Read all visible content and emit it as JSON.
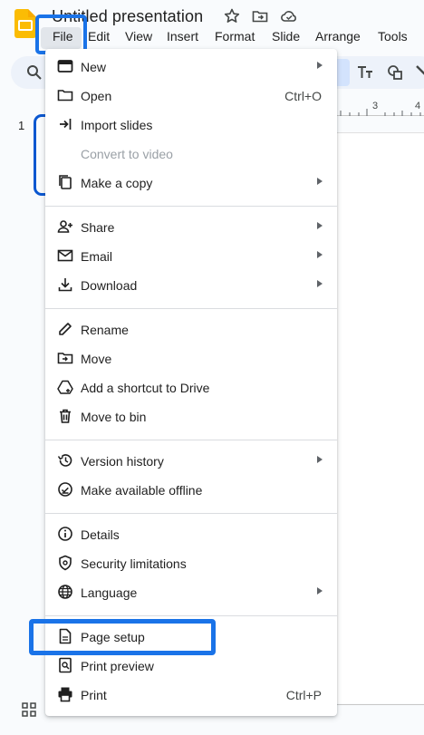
{
  "app": {
    "title": "Untitled presentation",
    "accent_color": "#1a73e8",
    "logo_color": "#fbbc04",
    "icons": [
      "star-icon",
      "move-to-folder-icon",
      "cloud-saved-icon"
    ]
  },
  "menubar": {
    "items": [
      "File",
      "Edit",
      "View",
      "Insert",
      "Format",
      "Slide",
      "Arrange",
      "Tools"
    ]
  },
  "ruler": {
    "labels": [
      "3",
      "4"
    ]
  },
  "slides": {
    "current_number": "1"
  },
  "file_menu": {
    "groups": [
      [
        {
          "label": "New",
          "icon": "new-presentation-icon",
          "submenu": true
        },
        {
          "label": "Open",
          "icon": "folder-icon",
          "shortcut": "Ctrl+O"
        },
        {
          "label": "Import slides",
          "icon": "import-icon"
        },
        {
          "label": "Convert to video",
          "icon": "",
          "disabled": true
        },
        {
          "label": "Make a copy",
          "icon": "copy-icon",
          "submenu": true
        }
      ],
      [
        {
          "label": "Share",
          "icon": "person-add-icon",
          "submenu": true
        },
        {
          "label": "Email",
          "icon": "email-icon",
          "submenu": true
        },
        {
          "label": "Download",
          "icon": "download-icon",
          "submenu": true
        }
      ],
      [
        {
          "label": "Rename",
          "icon": "pencil-icon"
        },
        {
          "label": "Move",
          "icon": "move-folder-icon"
        },
        {
          "label": "Add a shortcut to Drive",
          "icon": "drive-shortcut-icon"
        },
        {
          "label": "Move to bin",
          "icon": "trash-icon"
        }
      ],
      [
        {
          "label": "Version history",
          "icon": "history-icon",
          "submenu": true
        },
        {
          "label": "Make available offline",
          "icon": "offline-check-icon"
        }
      ],
      [
        {
          "label": "Details",
          "icon": "info-icon"
        },
        {
          "label": "Security limitations",
          "icon": "shield-icon"
        },
        {
          "label": "Language",
          "icon": "globe-icon",
          "submenu": true
        }
      ],
      [
        {
          "label": "Page setup",
          "icon": "page-icon"
        },
        {
          "label": "Print preview",
          "icon": "print-preview-icon"
        },
        {
          "label": "Print",
          "icon": "printer-icon",
          "shortcut": "Ctrl+P"
        }
      ]
    ]
  }
}
